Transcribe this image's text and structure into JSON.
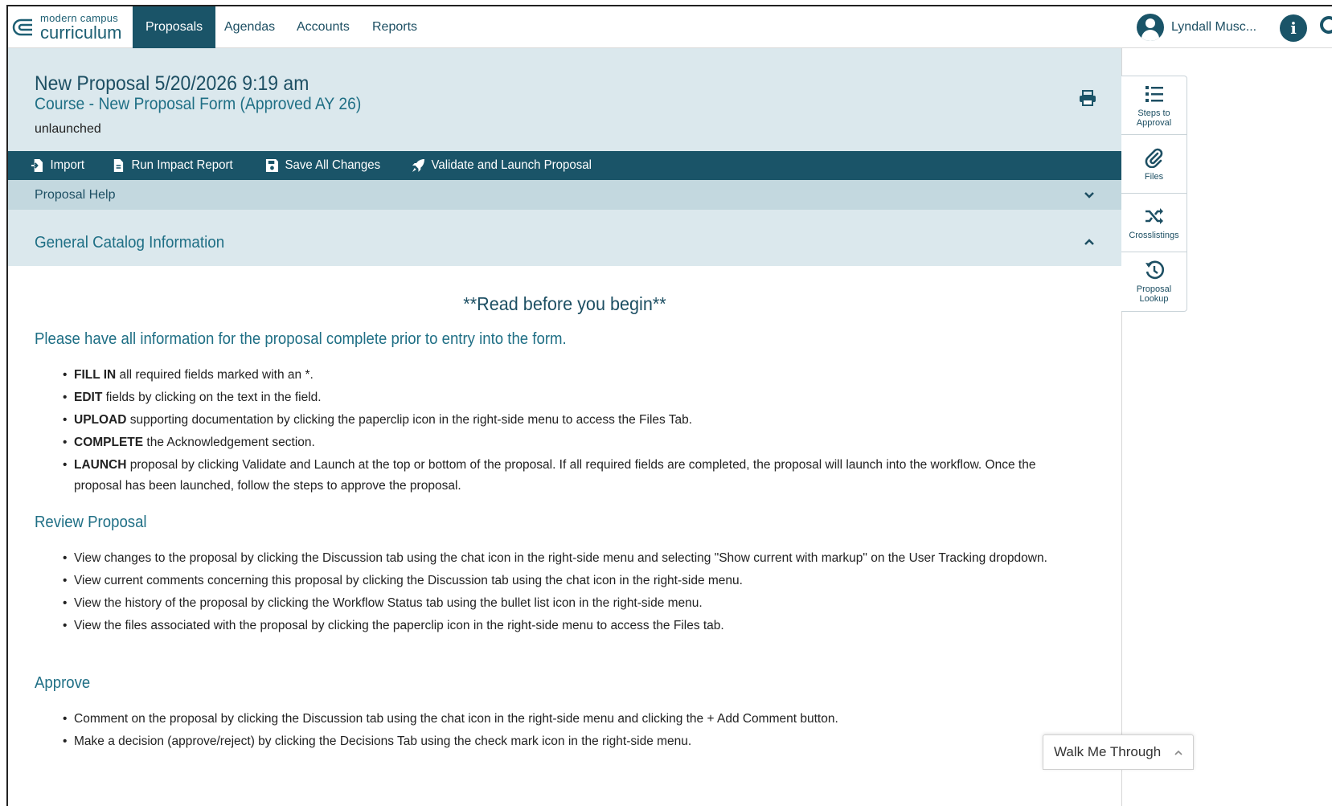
{
  "nav": {
    "logo_small": "modern campus",
    "logo_big": "curriculum",
    "items": [
      {
        "label": "Proposals",
        "active": true
      },
      {
        "label": "Agendas",
        "active": false
      },
      {
        "label": "Accounts",
        "active": false
      },
      {
        "label": "Reports",
        "active": false
      }
    ],
    "user_name": "Lyndall Musc...",
    "info_icon": "info-icon",
    "search_icon": "search-icon"
  },
  "header": {
    "title": "New Proposal 5/20/2026 9:19 am",
    "subtitle": "Course - New Proposal Form (Approved AY 26)",
    "status": "unlaunched"
  },
  "toolbar": {
    "import_label": "Import",
    "impact_label": "Run Impact Report",
    "save_label": "Save All Changes",
    "launch_label": "Validate and Launch Proposal"
  },
  "help": {
    "label": "Proposal Help"
  },
  "section": {
    "label": "General Catalog Information"
  },
  "content": {
    "read_before": "**Read before you begin**",
    "please_heading": "Please have all information for the proposal complete prior to entry into the form.",
    "instructions": [
      {
        "kw": "FILL IN",
        "text": " all required fields marked with an *."
      },
      {
        "kw": "EDIT",
        "text": " fields by clicking on the text in the field."
      },
      {
        "kw": "UPLOAD",
        "text": " supporting documentation by clicking the paperclip icon in the right-side menu to access the Files Tab."
      },
      {
        "kw": "COMPLETE",
        "text": " the Acknowledgement section."
      },
      {
        "kw": "LAUNCH",
        "text": " proposal by clicking Validate and Launch at the top or bottom of the proposal.  If all required fields are completed, the proposal will launch into the workflow. Once the proposal has been launched, follow the steps to approve the proposal."
      }
    ],
    "review_heading": "Review Proposal",
    "review_items": [
      "View changes to the proposal by clicking the Discussion tab using the chat icon in the right-side menu and selecting \"Show current with markup\" on the User Tracking dropdown.",
      "View current comments concerning this proposal by clicking the Discussion tab using the chat icon in the right-side menu.",
      "View the history of the proposal by clicking the Workflow Status tab using the bullet list icon in the right-side menu.",
      "View the files associated with the proposal by clicking the paperclip icon in the right-side menu to access the Files tab."
    ],
    "approve_heading": "Approve",
    "approve_items": [
      "Comment on the proposal by clicking the Discussion tab using the chat icon in the right-side menu and clicking the + Add Comment button.",
      "Make a decision (approve/reject) by clicking the Decisions Tab using the check mark icon in the right-side menu."
    ]
  },
  "side_menu": [
    {
      "label": "Steps to Approval",
      "icon": "list-icon"
    },
    {
      "label": "Files",
      "icon": "paperclip-icon"
    },
    {
      "label": "Crosslistings",
      "icon": "shuffle-icon"
    },
    {
      "label": "Proposal Lookup",
      "icon": "history-icon"
    }
  ],
  "walkme": {
    "label": "Walk Me Through"
  },
  "colors": {
    "primary": "#1a5468",
    "header_bg": "#dbe8ed",
    "help_bg": "#c3d8df",
    "heading_text": "#1f6f85"
  }
}
